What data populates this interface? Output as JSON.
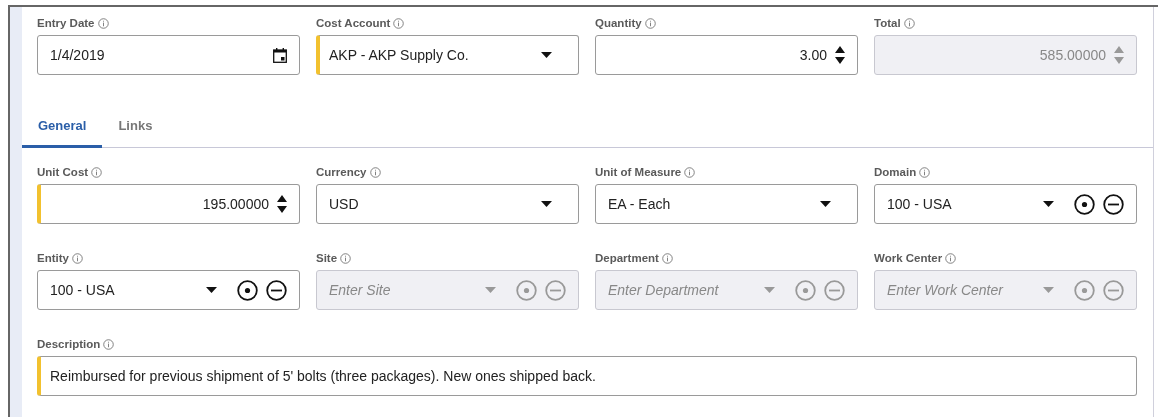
{
  "top_fields": [
    {
      "label": "Entry Date",
      "kind": "date",
      "value": "1/4/2019",
      "required": false,
      "disabled": false
    },
    {
      "label": "Cost Account",
      "kind": "select",
      "value": "AKP - AKP Supply Co.",
      "required": true,
      "disabled": false
    },
    {
      "label": "Quantity",
      "kind": "number",
      "value": "3.00",
      "required": false,
      "disabled": false
    },
    {
      "label": "Total",
      "kind": "number",
      "value": "585.00000",
      "required": false,
      "disabled": true
    }
  ],
  "tabs": [
    {
      "label": "General",
      "selected": true
    },
    {
      "label": "Links",
      "selected": false
    }
  ],
  "fields": [
    {
      "label": "Unit Cost",
      "kind": "number",
      "value": "195.00000",
      "required": true,
      "disabled": false
    },
    {
      "label": "Currency",
      "kind": "select",
      "value": "USD",
      "required": false,
      "disabled": false
    },
    {
      "label": "Unit of Measure",
      "kind": "select",
      "value": "EA - Each",
      "required": false,
      "disabled": false
    },
    {
      "label": "Domain",
      "kind": "lookup",
      "value": "100 - USA",
      "required": false,
      "disabled": false
    },
    {
      "label": "Entity",
      "kind": "lookup",
      "value": "100 - USA",
      "required": false,
      "disabled": false
    },
    {
      "label": "Site",
      "kind": "lookup",
      "placeholder": "Enter Site",
      "required": false,
      "disabled": true
    },
    {
      "label": "Department",
      "kind": "lookup",
      "placeholder": "Enter Department",
      "required": false,
      "disabled": true
    },
    {
      "label": "Work Center",
      "kind": "lookup",
      "placeholder": "Enter Work Center",
      "required": false,
      "disabled": true
    }
  ],
  "description": {
    "label": "Description",
    "value": "Reimbursed for previous shipment of 5' bolts (three packages). New ones shipped back.",
    "required": true,
    "disabled": false
  }
}
